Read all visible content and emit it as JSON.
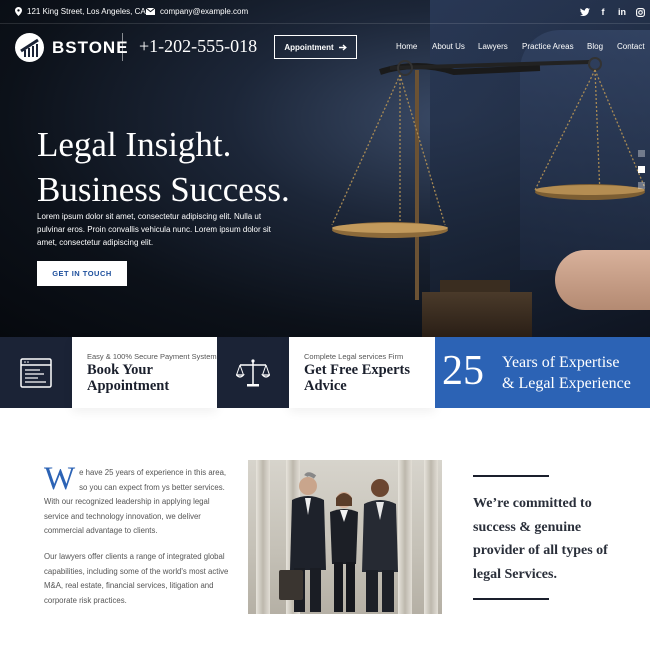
{
  "topbar": {
    "address": "121 King Street, Los Angeles, CA.",
    "email": "company@example.com",
    "social": [
      "twitter-icon",
      "facebook-icon",
      "linkedin-icon",
      "instagram-icon"
    ]
  },
  "header": {
    "logo_text": "BSTONE",
    "phone": "+1-202-555-018",
    "appointment_label": "Appointment",
    "nav": [
      "Home",
      "About Us",
      "Lawyers",
      "Practice Areas",
      "Blog",
      "Contact"
    ]
  },
  "hero": {
    "headline_line1": "Legal Insight.",
    "headline_line2": "Business Success.",
    "text": "Lorem ipsum dolor sit amet, consectetur adipiscing elit. Nulla ut pulvinar eros. Proin convallis vehicula nunc. Lorem ipsum dolor sit amet, consectetur adipiscing elit.",
    "cta_label": "GET IN TOUCH",
    "slides": 3,
    "active_slide": 2
  },
  "features": [
    {
      "icon": "payment-document-icon",
      "small": "Easy & 100% Secure Payment System",
      "title_line1": "Book Your",
      "title_line2": "Appointment"
    },
    {
      "icon": "scales-of-justice-icon",
      "small": "Complete Legal services Firm",
      "title_line1": "Get Free Experts",
      "title_line2": "Advice"
    }
  ],
  "stats": {
    "number": "25",
    "line1": "Years of Expertise",
    "line2": "& Legal Experience"
  },
  "about": {
    "dropcap": "W",
    "para1": "e have 25 years of experience in this area, so you can expect from ys better services. With our recognized leadership in applying legal service and technology innovation, we deliver commercial advantage to clients.",
    "para2": "Our lawyers offer clients a range of integrated global capabilities, including some of the world's most active M&A, real estate, financial services, litigation and corporate risk practices.",
    "quote": "We’re committed to success & genuine provider of all types of legal Services."
  },
  "colors": {
    "accent": "#2c63b5",
    "dark": "#1b2336"
  }
}
